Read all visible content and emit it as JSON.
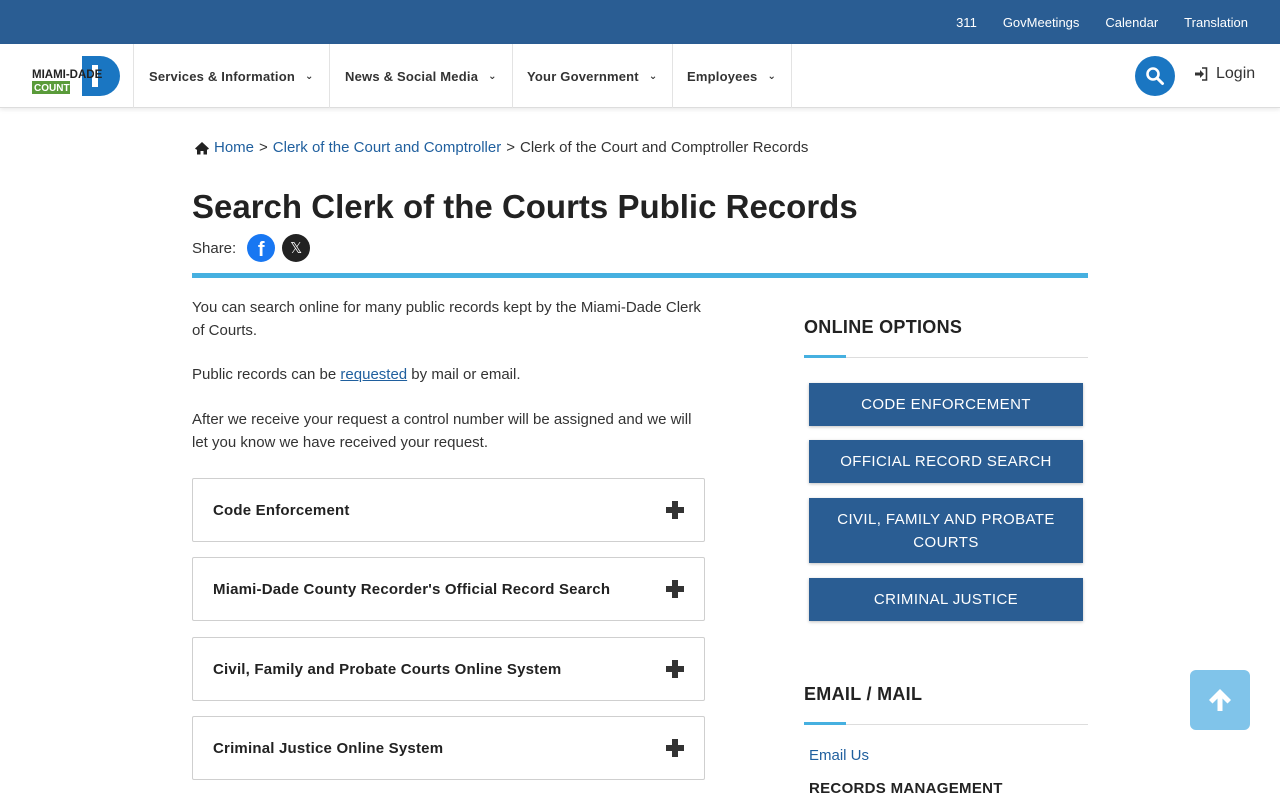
{
  "utility": {
    "links": [
      "311",
      "GovMeetings",
      "Calendar",
      "Translation"
    ]
  },
  "logo": {
    "line1": "MIAMI-DADE",
    "line2": "COUNTY"
  },
  "nav": {
    "items": [
      "Services & Information",
      "News & Social Media",
      "Your Government",
      "Employees"
    ],
    "login": "Login"
  },
  "breadcrumb": {
    "home": "Home",
    "parent": "Clerk of the Court and Comptroller",
    "current": "Clerk of the Court and Comptroller Records",
    "separator": ">"
  },
  "page": {
    "title": "Search Clerk of the Courts Public Records",
    "share_label": "Share:"
  },
  "body": {
    "p1": "You can search online for many public records kept by the Miami-Dade Clerk of Courts.",
    "p2_before": "Public records can be ",
    "p2_link": "requested",
    "p2_after": " by mail or email.",
    "p3": "After we receive your request a control number will be assigned and we will let you know we have received your request."
  },
  "accordion": [
    "Code Enforcement",
    "Miami-Dade County Recorder's Official Record Search",
    "Civil, Family and Probate Courts Online System",
    "Criminal Justice Online System"
  ],
  "sidebar": {
    "online_heading": "ONLINE OPTIONS",
    "buttons": [
      "CODE ENFORCEMENT",
      "OFFICIAL RECORD SEARCH",
      "CIVIL, FAMILY AND PROBATE COURTS",
      "CRIMINAL JUSTICE"
    ],
    "email_heading": "EMAIL / MAIL",
    "email_link": "Email Us",
    "records_heading": "RECORDS MANAGEMENT"
  },
  "colors": {
    "brand_blue": "#2a5d93",
    "accent_cyan": "#46b0e0",
    "search_blue": "#1a76c2",
    "logo_green": "#5a9b3a"
  }
}
